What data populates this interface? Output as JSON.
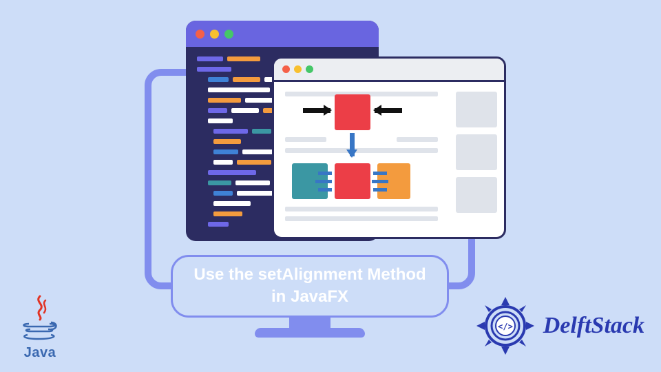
{
  "title": "Use the setAlignment Method in JavaFX",
  "logos": {
    "java_label": "Java",
    "delftstack_label": "DelftStack"
  },
  "colors": {
    "background": "#cdddf8",
    "monitor_frame": "#818dee",
    "code_bg": "#2c2c61",
    "code_titlebar": "#6965e0",
    "red": "#ec3e47",
    "teal": "#3b97a3",
    "orange": "#f39b3e",
    "blue_arrow": "#3876c5",
    "delft_blue": "#2a3ab0"
  }
}
